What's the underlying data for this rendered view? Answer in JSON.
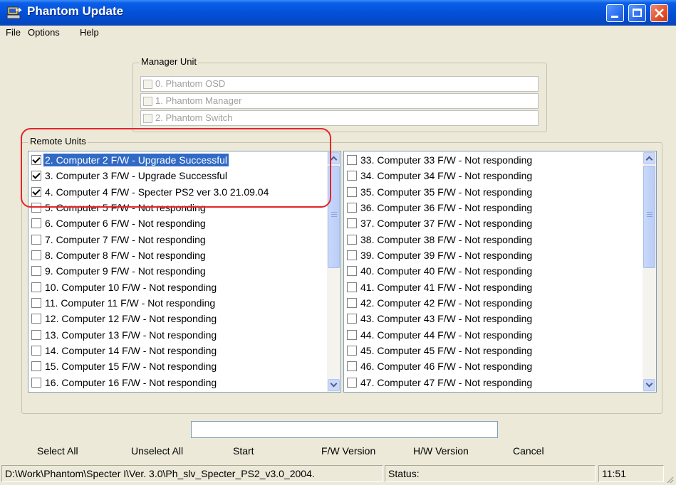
{
  "window": {
    "title": "Phantom Update"
  },
  "menu": [
    "File",
    "Options",
    "Help"
  ],
  "manager_unit": {
    "label": "Manager Unit",
    "items": [
      "0. Phantom OSD",
      "1. Phantom Manager",
      "2. Phantom Switch"
    ]
  },
  "remote_units": {
    "label": "Remote Units",
    "left_list": [
      {
        "text": "2. Computer 2 F/W - Upgrade Successful",
        "checked": true,
        "selected": true
      },
      {
        "text": "3. Computer 3 F/W - Upgrade Successful",
        "checked": true,
        "selected": false
      },
      {
        "text": "4. Computer 4 F/W - Specter PS2 ver 3.0 21.09.04",
        "checked": true,
        "selected": false
      },
      {
        "text": "5. Computer 5 F/W - Not responding",
        "checked": false,
        "selected": false
      },
      {
        "text": "6. Computer 6 F/W - Not responding",
        "checked": false,
        "selected": false
      },
      {
        "text": "7. Computer 7 F/W - Not responding",
        "checked": false,
        "selected": false
      },
      {
        "text": "8. Computer 8 F/W - Not responding",
        "checked": false,
        "selected": false
      },
      {
        "text": "9. Computer 9 F/W - Not responding",
        "checked": false,
        "selected": false
      },
      {
        "text": "10. Computer 10 F/W - Not responding",
        "checked": false,
        "selected": false
      },
      {
        "text": "11. Computer 11 F/W - Not responding",
        "checked": false,
        "selected": false
      },
      {
        "text": "12. Computer 12 F/W - Not responding",
        "checked": false,
        "selected": false
      },
      {
        "text": "13. Computer 13 F/W - Not responding",
        "checked": false,
        "selected": false
      },
      {
        "text": "14. Computer 14 F/W - Not responding",
        "checked": false,
        "selected": false
      },
      {
        "text": "15. Computer 15 F/W - Not responding",
        "checked": false,
        "selected": false
      },
      {
        "text": "16. Computer 16 F/W - Not responding",
        "checked": false,
        "selected": false
      }
    ],
    "right_list": [
      {
        "text": "33. Computer 33 F/W - Not responding",
        "checked": false
      },
      {
        "text": "34. Computer 34 F/W - Not responding",
        "checked": false
      },
      {
        "text": "35. Computer 35 F/W - Not responding",
        "checked": false
      },
      {
        "text": "36. Computer 36 F/W - Not responding",
        "checked": false
      },
      {
        "text": "37. Computer 37 F/W - Not responding",
        "checked": false
      },
      {
        "text": "38. Computer 38 F/W - Not responding",
        "checked": false
      },
      {
        "text": "39. Computer 39 F/W - Not responding",
        "checked": false
      },
      {
        "text": "40. Computer 40 F/W - Not responding",
        "checked": false
      },
      {
        "text": "41. Computer 41 F/W - Not responding",
        "checked": false
      },
      {
        "text": "42. Computer 42 F/W - Not responding",
        "checked": false
      },
      {
        "text": "43. Computer 43 F/W - Not responding",
        "checked": false
      },
      {
        "text": "44. Computer 44 F/W - Not responding",
        "checked": false
      },
      {
        "text": "45. Computer 45 F/W - Not responding",
        "checked": false
      },
      {
        "text": "46. Computer 46 F/W - Not responding",
        "checked": false
      },
      {
        "text": "47. Computer 47 F/W - Not responding",
        "checked": false
      }
    ]
  },
  "progress_text": "",
  "buttons": {
    "select_all": "Select All",
    "unselect_all": "Unselect All",
    "start": "Start",
    "fw_version": "F/W Version",
    "hw_version": "H/W Version",
    "cancel": "Cancel"
  },
  "status_bar": {
    "path": "D:\\Work\\Phantom\\Specter I\\Ver. 3.0\\Ph_slv_Specter_PS2_v3.0_2004.",
    "status": "Status:",
    "time": "11:51"
  },
  "colors": {
    "selection": "#316ac5",
    "annotation": "#e0262a",
    "titlebar": "#0451d8"
  }
}
